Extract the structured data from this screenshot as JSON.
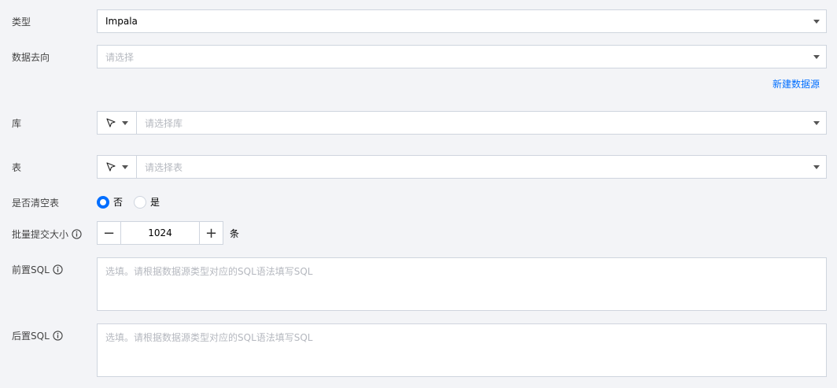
{
  "type": {
    "label": "类型",
    "value": "Impala"
  },
  "target": {
    "label": "数据去向",
    "placeholder": "请选择",
    "new_link": "新建数据源"
  },
  "database": {
    "label": "库",
    "placeholder": "请选择库"
  },
  "table": {
    "label": "表",
    "placeholder": "请选择表"
  },
  "truncate": {
    "label": "是否清空表",
    "options": [
      "否",
      "是"
    ],
    "selected": "否"
  },
  "batch": {
    "label": "批量提交大小",
    "value": "1024",
    "unit": "条",
    "minus": "−",
    "plus": "+"
  },
  "pre_sql": {
    "label": "前置SQL",
    "placeholder": "选填。请根据数据源类型对应的SQL语法填写SQL"
  },
  "post_sql": {
    "label": "后置SQL",
    "placeholder": "选填。请根据数据源类型对应的SQL语法填写SQL"
  }
}
